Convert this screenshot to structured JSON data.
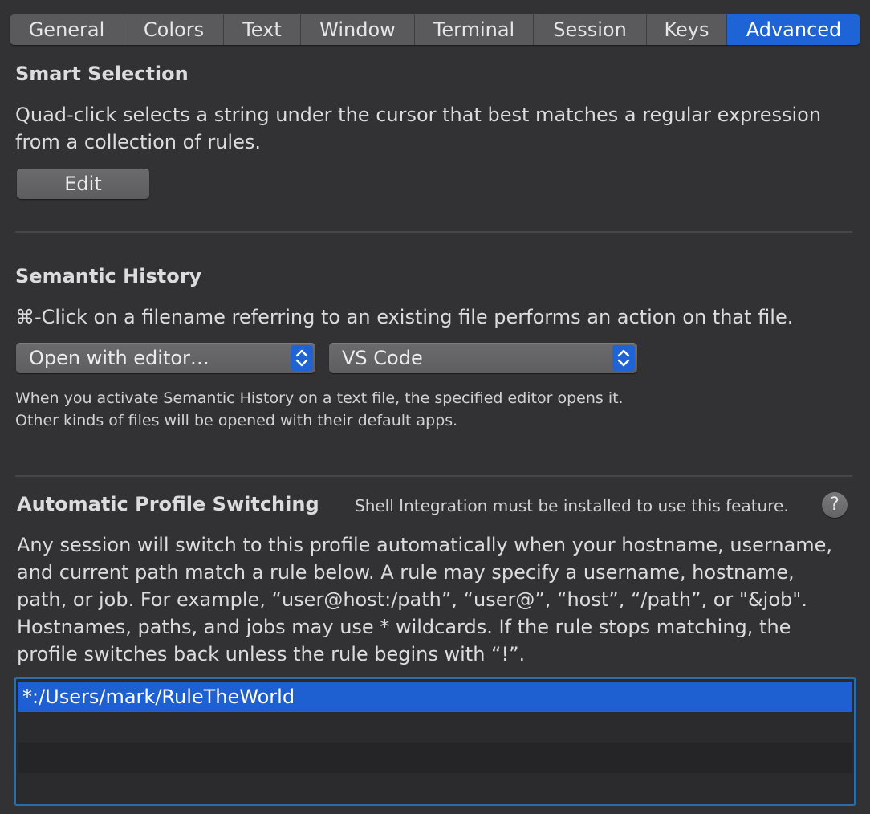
{
  "tabs": [
    {
      "label": "General",
      "active": false
    },
    {
      "label": "Colors",
      "active": false
    },
    {
      "label": "Text",
      "active": false
    },
    {
      "label": "Window",
      "active": false
    },
    {
      "label": "Terminal",
      "active": false
    },
    {
      "label": "Session",
      "active": false
    },
    {
      "label": "Keys",
      "active": false
    },
    {
      "label": "Advanced",
      "active": true
    }
  ],
  "smart_selection": {
    "title": "Smart Selection",
    "description_line1": "Quad-click selects a string under the cursor that best matches a regular expression",
    "description_line2": "from a collection of rules.",
    "edit_label": "Edit"
  },
  "semantic_history": {
    "title": "Semantic History",
    "description": "⌘-Click on a filename referring to an existing file performs an action on that file.",
    "action_select": "Open with editor…",
    "editor_select": "VS Code",
    "note_line1": "When you activate Semantic History on a text file, the specified editor opens it.",
    "note_line2": "Other kinds of files will be opened with their default apps."
  },
  "profile_switching": {
    "title": "Automatic Profile Switching",
    "shell_note": "Shell Integration must be installed to use this feature.",
    "help_label": "?",
    "description_lines": [
      "Any session will switch to this profile automatically when your hostname, username,",
      "and current path match a rule below. A rule may specify a username, hostname,",
      "path, or job. For example, “user@host:/path”, “user@”, “host”, “/path”, or \"&job\".",
      "Hostnames, paths, and jobs may use * wildcards. If the rule stops matching, the",
      "profile switches back unless the rule begins with “!”."
    ],
    "rules": [
      {
        "text": "*:/Users/mark/RuleTheWorld",
        "selected": true
      }
    ]
  },
  "colors": {
    "accent": "#1e64d6",
    "background": "#323235",
    "list_border": "#2b6da8"
  }
}
